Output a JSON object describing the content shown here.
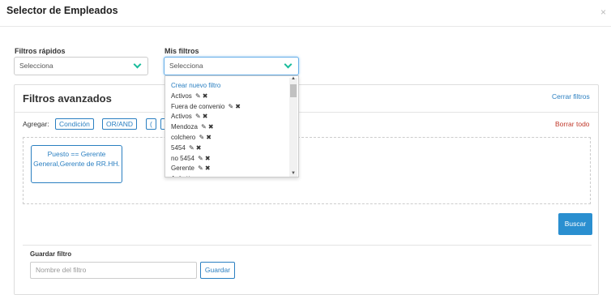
{
  "modal": {
    "title": "Selector de Empleados",
    "close": "×"
  },
  "quick_filters": {
    "label": "Filtros rápidos",
    "value": "Selecciona"
  },
  "my_filters": {
    "label": "Mis filtros",
    "value": "Selecciona"
  },
  "advanced": {
    "title": "Filtros avanzados",
    "clear_filters": "Cerrar filtros",
    "clear_all": "Borrar todo",
    "add_label": "Agregar:",
    "chips": [
      "Condición",
      "OR/AND",
      "(",
      "("
    ],
    "filter_card": "Puesto == Gerente General,Gerente de RR.HH.",
    "search_button": "Buscar"
  },
  "save": {
    "label": "Guardar filtro",
    "placeholder": "Nombre del filtro",
    "button": "Guardar"
  },
  "dropdown": {
    "create": "Crear nuevo filtro",
    "items": [
      "Activos",
      "Fuera de convenio",
      "Activos",
      "Mendoza",
      "colchero",
      "5454",
      "no 5454",
      "Gerente",
      "A"
    ]
  },
  "colors": {
    "accent_teal": "#1abc9c",
    "link_blue": "#2a7fc1",
    "danger_red": "#c0392b",
    "primary_button": "#2a8fd0"
  },
  "icons": {
    "edit": "edit-icon",
    "delete": "delete-icon",
    "chevron": "chevron-down-icon"
  }
}
